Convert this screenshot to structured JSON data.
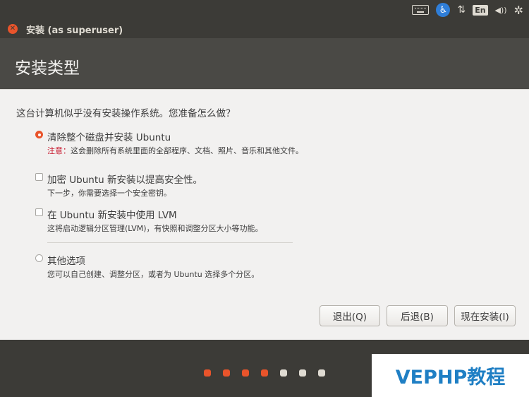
{
  "tray": {
    "keyboard_icon": "keyboard-icon",
    "accessibility_icon": "accessibility-icon",
    "accessibility_glyph": "♿",
    "network_glyph": "⇅",
    "language": "En",
    "volume_glyph": "◀))",
    "settings_glyph": "✲"
  },
  "window": {
    "title": "安装 (as superuser)",
    "close_glyph": "✕"
  },
  "header": {
    "title": "安装类型"
  },
  "main": {
    "question": "这台计算机似乎没有安装操作系统。您准备怎么做？",
    "options": [
      {
        "label": "清除整个磁盘并安装 Ubuntu",
        "warning_prefix": "注意：",
        "desc": "这会删除所有系统里面的全部程序、文档、照片、音乐和其他文件。",
        "selected": true
      },
      {
        "label": "加密 Ubuntu 新安装以提高安全性。",
        "desc": "下一步，你需要选择一个安全密钥。",
        "checked": false
      },
      {
        "label": "在 Ubuntu 新安装中使用 LVM",
        "desc": "这将启动逻辑分区管理(LVM)，有快照和调整分区大小等功能。",
        "checked": false
      },
      {
        "label": "其他选项",
        "desc": "您可以自己创建、调整分区，或者为 Ubuntu 选择多个分区。",
        "selected": false
      }
    ],
    "buttons": {
      "quit": "退出(Q)",
      "back": "后退(B)",
      "install": "现在安装(I)"
    }
  },
  "footer": {
    "progress": {
      "completed": 4,
      "total": 7,
      "done_color": "#e9542b",
      "pending_color": "#dfdbd2"
    },
    "watermark": "VEPHP教程"
  }
}
